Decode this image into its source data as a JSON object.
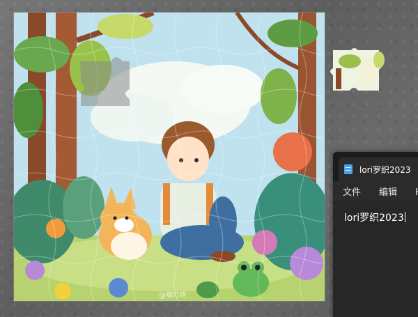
{
  "puzzle": {
    "watermark": "@哪叮咚"
  },
  "notepad": {
    "tab_icon": "notepad-icon",
    "tab_title": "lori罗织2023",
    "menus": [
      "文件",
      "编辑",
      "H 也"
    ],
    "text": "lori罗织2023"
  },
  "colors": {
    "background": "#6b6b6b",
    "notepad_bg": "#202020",
    "notepad_tab": "#2b2b2b"
  }
}
